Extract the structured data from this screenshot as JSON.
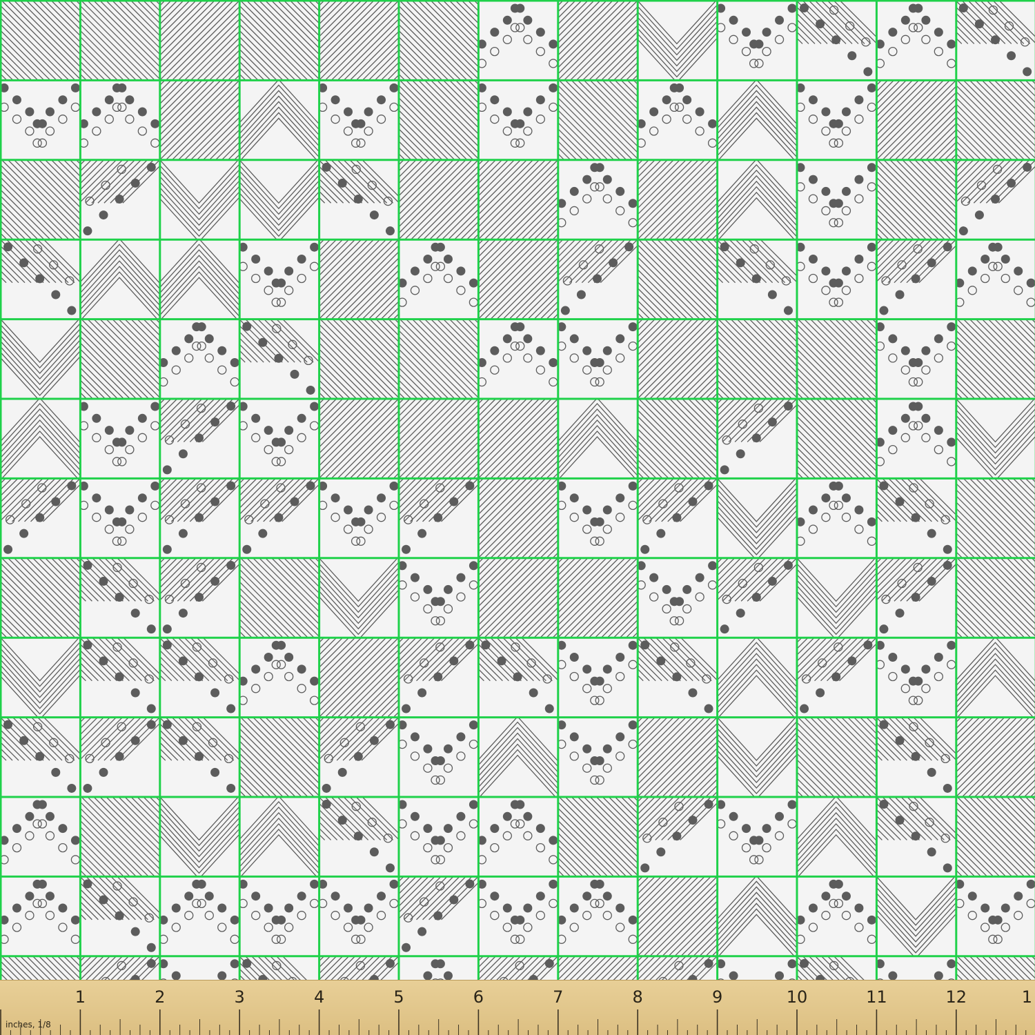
{
  "fabric": {
    "pattern": "geometric patchwork: diagonal stripes, chevrons, polka dots and rings",
    "background_color": "#f4f4f4",
    "ink_color": "#5c5c5c",
    "grid_line_color": "#1fd14a",
    "grid_columns": 13,
    "grid_rows": 13
  },
  "ruler": {
    "units_label": "inches, 1/8",
    "numbers": [
      "1",
      "2",
      "3",
      "4",
      "5",
      "6",
      "7",
      "8",
      "9",
      "10",
      "11",
      "12",
      "1"
    ],
    "color": "#e2c78c"
  }
}
